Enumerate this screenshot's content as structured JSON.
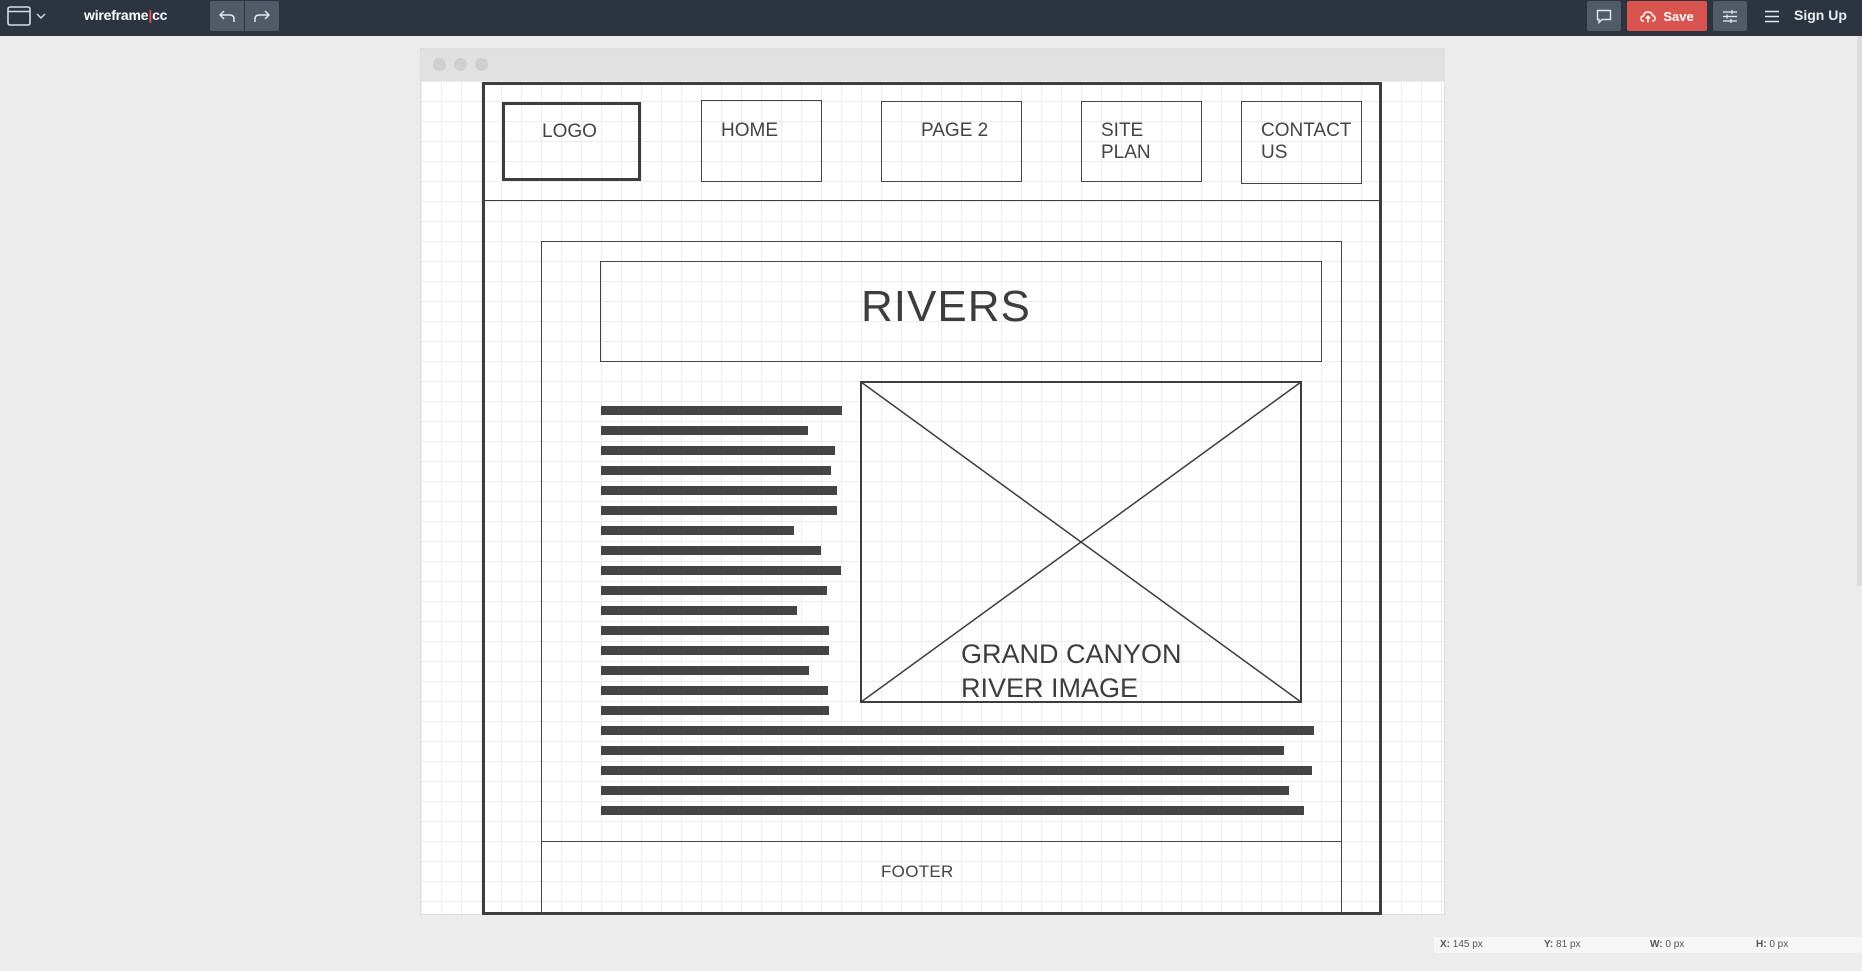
{
  "app": {
    "brand_main": "wireframe",
    "brand_sep": "|",
    "brand_tail": "cc",
    "save_label": "Save",
    "signup_label": "Sign Up"
  },
  "icons": {
    "window": "browser-window-icon",
    "chevron": "chevron-down-icon",
    "undo": "undo-icon",
    "redo": "redo-icon",
    "comment": "comment-icon",
    "upload": "cloud-upload-icon",
    "settings": "sliders-icon",
    "menu": "hamburger-menu-icon"
  },
  "colors": {
    "topbar": "#2d3441",
    "save": "#d9534f",
    "wireframe_ink": "#444444"
  },
  "wireframe": {
    "nav": {
      "logo": "LOGO",
      "home": "HOME",
      "page2": "PAGE 2",
      "site_plan_1": "SITE",
      "site_plan_2": "PLAN",
      "contact_1": "CONTACT",
      "contact_2": "US"
    },
    "title": "RIVERS",
    "image_caption_1": "GRAND CANYON",
    "image_caption_2": "RIVER IMAGE",
    "footer": "FOOTER"
  },
  "status": {
    "x_label": "X:",
    "x_value": "145 px",
    "y_label": "Y:",
    "y_value": "81 px",
    "w_label": "W:",
    "w_value": "0 px",
    "h_label": "H:",
    "h_value": "0 px"
  }
}
